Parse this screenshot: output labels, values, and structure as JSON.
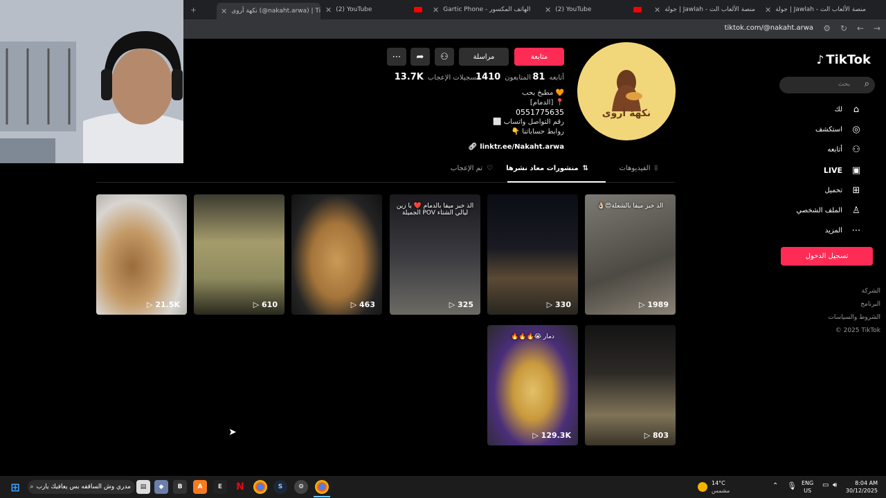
{
  "browser": {
    "tabs": [
      {
        "label": "نكهة أروى (@nakaht.arwa) | TikTok"
      },
      {
        "label": "(2) YouTube"
      },
      {
        "label": "Gartic Phone - الهاتف المكسور"
      },
      {
        "label": "(2) YouTube"
      },
      {
        "label": "جولة | Jawlah - منصة الألعاب الت"
      },
      {
        "label": "جولة | Jawlah - منصة الألعاب الت"
      }
    ],
    "url": "tiktok.com/@nakaht.arwa"
  },
  "sidebar": {
    "logo": "TikTok",
    "search_placeholder": "بحث",
    "items": [
      {
        "label": "لك"
      },
      {
        "label": "استكشف"
      },
      {
        "label": "أتابعه"
      },
      {
        "label": "LIVE"
      },
      {
        "label": "تحميل"
      },
      {
        "label": "الملف الشخصي"
      },
      {
        "label": "المزيد"
      }
    ],
    "login_label": "تسجيل الدخول",
    "footer": [
      "الشركة",
      "البرنامج",
      "الشروط والسياسات",
      "© 2025 TikTok"
    ]
  },
  "profile": {
    "avatar_text": "نكهة أروى",
    "follow_label": "متابعة",
    "message_label": "مراسلة",
    "stats": {
      "following_value": "81",
      "following_label": "أتابعه",
      "followers_value": "1410",
      "followers_label": "المتابعون",
      "likes_value": "13.7K",
      "likes_label": "تسجيلات الإعجاب"
    },
    "bio": [
      "🧡 مطبخ بحب",
      "📍 [الدمام]",
      "0551775635",
      "رقم التواصل واتساب ⬜",
      "روابط حساباتنا 👇"
    ],
    "link": "linktr.ee/Nakaht.arwa",
    "tabs": {
      "videos": "الفيديوهات",
      "reposts": "منشورات معاد نشرها",
      "liked": "تم الإعجاب"
    }
  },
  "videos": [
    {
      "views": "1989",
      "caption": "الذ خبز ميفا بالشعلة😍👌🏻"
    },
    {
      "views": "330",
      "caption": ""
    },
    {
      "views": "325",
      "caption": "الذ خبز ميفا بالدمام ❤️ يا زين ليالي الشتاء POV الجميلة"
    },
    {
      "views": "463",
      "caption": ""
    },
    {
      "views": "610",
      "caption": ""
    },
    {
      "views": "21.5K",
      "caption": ""
    },
    {
      "views": "803",
      "caption": ""
    },
    {
      "views": "129.3K",
      "caption": "دمار 😭🔥🔥🔥"
    }
  ],
  "taskbar": {
    "search_text": "مدري وش الساقفه بس يعافيك يارب",
    "weather_temp": "14°C",
    "weather_desc": "مشمس",
    "lang": "ENG",
    "region": "US",
    "time": "8:04 AM",
    "date": "30/12/2025"
  }
}
